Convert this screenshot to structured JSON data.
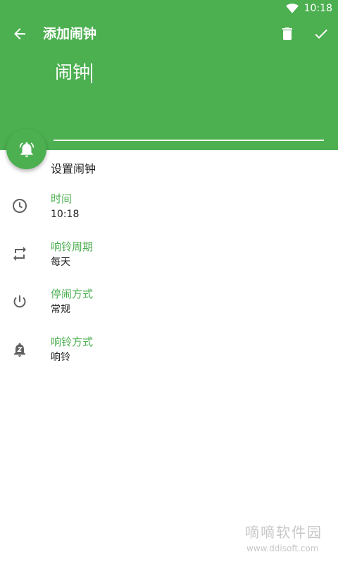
{
  "status_bar": {
    "time": "10:18",
    "wifi_icon": "wifi-icon"
  },
  "toolbar": {
    "title": "添加闹钟",
    "back_icon": "arrow-back-icon",
    "delete_icon": "trash-icon",
    "confirm_icon": "check-icon"
  },
  "alarm_name": {
    "value": "闹钟"
  },
  "fab": {
    "icon": "bell-icon"
  },
  "section_title": "设置闹钟",
  "settings": [
    {
      "label": "时间",
      "value": "10:18",
      "icon": "clock-icon"
    },
    {
      "label": "响铃周期",
      "value": "每天",
      "icon": "repeat-icon"
    },
    {
      "label": "停闹方式",
      "value": "常规",
      "icon": "power-icon"
    },
    {
      "label": "响铃方式",
      "value": "响铃",
      "icon": "bell-z-icon"
    }
  ],
  "watermark": {
    "title": "嘀嘀软件园",
    "url": "www.ddisoft.com"
  },
  "colors": {
    "accent": "#4caf50",
    "icon_gray": "#616161",
    "text": "#212121"
  }
}
